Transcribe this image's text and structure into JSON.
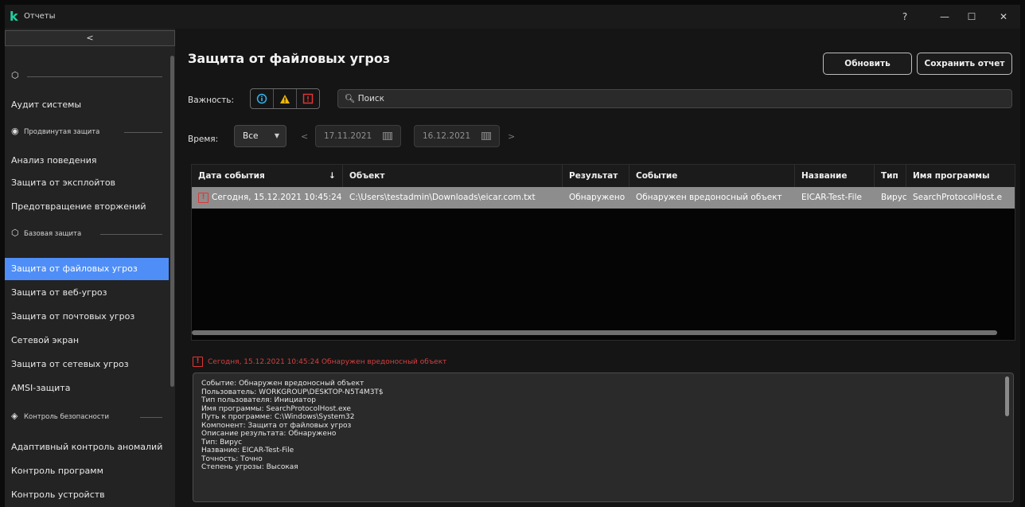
{
  "window": {
    "title": "Отчеты",
    "help": "?",
    "minimize": "—",
    "maximize": "☐",
    "close": "✕"
  },
  "sidebar": {
    "collapse": "<",
    "groups": [
      {
        "label": "",
        "icon": "shield-outline-icon"
      },
      {
        "label": "Продвинутая защита",
        "icon": "shield-gear-icon"
      },
      {
        "label": "Базовая защита",
        "icon": "shield-outline-icon"
      },
      {
        "label": "Контроль безопасности",
        "icon": "shield-control-icon"
      }
    ],
    "items": [
      "Аудит системы",
      "Анализ поведения",
      "Защита от эксплойтов",
      "Предотвращение вторжений",
      "Защита от файловых угроз",
      "Защита от веб-угроз",
      "Защита от почтовых угроз",
      "Сетевой экран",
      "Защита от сетевых угроз",
      "AMSI-защита",
      "Адаптивный контроль аномалий",
      "Контроль программ",
      "Контроль устройств"
    ],
    "active_item": "Защита от файловых угроз"
  },
  "main": {
    "title": "Защита от файловых угроз",
    "refresh_label": "Обновить",
    "save_label": "Сохранить отчет",
    "severity_label": "Важность:",
    "search_placeholder": "Поиск",
    "time_label": "Время:",
    "time_value": "Все",
    "date_from": "17.11.2021",
    "date_to": "16.12.2021",
    "table": {
      "columns": [
        "Дата события",
        "Объект",
        "Результат",
        "Событие",
        "Название",
        "Тип",
        "Имя программы"
      ],
      "sort_indicator": "↓",
      "rows": [
        [
          "Сегодня, 15.12.2021 10:45:24",
          "C:\\Users\\testadmin\\Downloads\\eicar.com.txt",
          "Обнаружено",
          "Обнаружен вредоносный объект",
          "EICAR-Test-File",
          "Вирус",
          "SearchProtocolHost.e"
        ]
      ]
    },
    "event_summary": "Сегодня, 15.12.2021 10:45:24 Обнаружен вредоносный объект",
    "details": [
      "Событие: Обнаружен вредоносный объект",
      "Пользователь: WORKGROUP\\DESKTOP-N5T4M3T$",
      "Тип пользователя: Инициатор",
      "Имя программы: SearchProtocolHost.exe",
      "Путь к программе: C:\\Windows\\System32",
      "Компонент: Защита от файловых угроз",
      "Описание результата: Обнаружено",
      "Тип: Вирус",
      "Название: EICAR-Test-File",
      "Точность: Точно",
      "Степень угрозы: Высокая"
    ]
  },
  "colors": {
    "accent": "#4f8ef7",
    "critical": "#e03535",
    "warning": "#f2b705",
    "info": "#2fb6f0",
    "logo": "#1fd0a0"
  }
}
